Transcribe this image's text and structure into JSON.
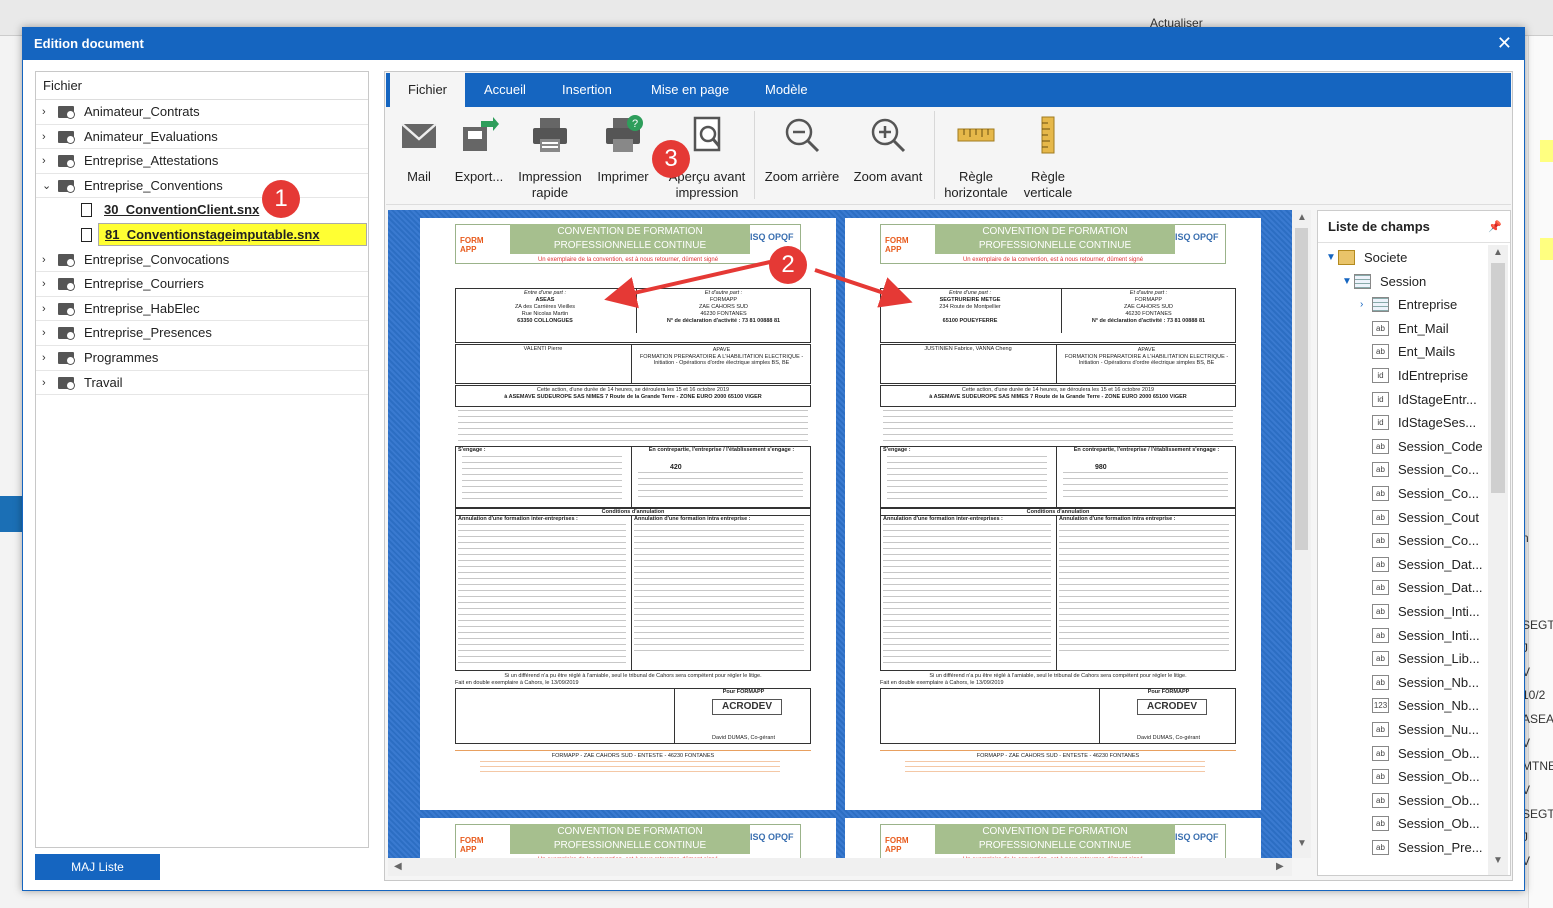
{
  "background": {
    "refresh_label": "Actualiser",
    "right_texts": [
      "n",
      "SEGT",
      "J",
      "V",
      "10/2",
      "ASEA",
      "V",
      "MTNE",
      "V",
      "SEGT",
      "J",
      "V"
    ]
  },
  "dialog": {
    "title": "Edition document",
    "close_glyph": "✕"
  },
  "tree": {
    "header": "Fichier",
    "folders": [
      {
        "label": "Animateur_Contrats",
        "expanded": false
      },
      {
        "label": "Animateur_Evaluations",
        "expanded": false
      },
      {
        "label": "Entreprise_Attestations",
        "expanded": false
      },
      {
        "label": "Entreprise_Conventions",
        "expanded": true
      },
      {
        "label": "Entreprise_Convocations",
        "expanded": false
      },
      {
        "label": "Entreprise_Courriers",
        "expanded": false
      },
      {
        "label": "Entreprise_HabElec",
        "expanded": false
      },
      {
        "label": "Entreprise_Presences",
        "expanded": false
      },
      {
        "label": "Programmes",
        "expanded": false
      },
      {
        "label": "Travail",
        "expanded": false
      }
    ],
    "files": [
      {
        "label": "30_ConventionClient.snx",
        "selected": false
      },
      {
        "label": "81_Conventionstageimputable.snx",
        "selected": true
      }
    ],
    "update_button": "MAJ Liste"
  },
  "ribbon": {
    "tabs": [
      "Fichier",
      "Accueil",
      "Insertion",
      "Mise en page",
      "Modèle"
    ],
    "active_tab": "Fichier",
    "buttons": [
      {
        "label": "Mail",
        "icon": "mail-icon"
      },
      {
        "label": "Export...",
        "icon": "export-icon"
      },
      {
        "label": "Impression rapide",
        "icon": "quick-print-icon"
      },
      {
        "label": "Imprimer",
        "icon": "print-icon"
      },
      {
        "label": "Aperçu avant impression",
        "icon": "print-preview-icon"
      },
      {
        "label": "Zoom arrière",
        "icon": "zoom-out-icon"
      },
      {
        "label": "Zoom avant",
        "icon": "zoom-in-icon"
      },
      {
        "label": "Règle horizontale",
        "icon": "horizontal-ruler-icon"
      },
      {
        "label": "Règle verticale",
        "icon": "vertical-ruler-icon"
      }
    ]
  },
  "preview": {
    "doc_title_1": "CONVENTION DE FORMATION",
    "doc_title_2": "PROFESSIONNELLE CONTINUE",
    "logo_left": "FORM APP",
    "logo_right": "ISQ OPQF",
    "subtitle": "Un exemplaire de la convention, est à nous retourner, dûment signé",
    "pages": [
      {
        "party_label": "Entre d'une part :",
        "party_name": "ASEAS",
        "party_addr1": "ZA des Carrières Vieilles",
        "party_addr2": "Rue Nicolas Martin",
        "party_addr3": "63350 COLLONGUES",
        "participant": "VALENTI Pierre",
        "price": "420"
      },
      {
        "party_label": "Entre d'une part :",
        "party_name": "SEGTRUREIRE METGE",
        "party_addr1": "234 Route de Montpellier",
        "party_addr2": "",
        "party_addr3": "65100 POUEYFERRE",
        "participant": "JUSTINIEN Fabrice, VANNA Cheng",
        "price": "980"
      }
    ],
    "other_party_label": "Et d'autre part :",
    "other_party_name": "FORMAPP",
    "other_party_addr1": "ZAE CAHORS SUD",
    "other_party_addr2": "46230 FONTANES",
    "other_party_decl": "N° de déclaration d'activité : 73 81 00888 81",
    "course_org": "APAVE",
    "course_title": "FORMATION PREPARATOIRE A L'HABILITATION ELECTRIQUE - Initiation - Opérations d'ordre électrique simples BS, BE",
    "duration_line": "Cette action, d'une durée de 14 heures, se déroulera les 15 et 16 octobre 2019",
    "location_line": "à ASEMAVE SUDEUROPE SAS NIMES 7 Route de la Grande Terre - ZONE EURO 2000 65100 VIGER",
    "engage_label": "S'engage :",
    "counterpart_label": "En contrepartie, l'entreprise / l'établissement s'engage :",
    "conditions_label": "Conditions d'annulation",
    "cancel_inter": "Annulation d'une formation inter-entreprises :",
    "cancel_intra": "Annulation d'une formation intra entreprise :",
    "litigation": "Si un différend n'a pu être réglé à l'amiable, seul le tribunal de Cahors sera compétent pour régler le litige.",
    "signed_at": "Fait en double exemplaire à Cahors, le 13/09/2019",
    "pour": "Pour FORMAPP",
    "stamp": "ACRODEV",
    "signer": "David DUMAS, Co-gérant",
    "footer": "FORMAPP - ZAE CAHORS SUD - ENTESTE - 46230 FONTANES"
  },
  "fields": {
    "header": "Liste de champs",
    "items": [
      {
        "label": "Societe",
        "kind": "db",
        "level": 0,
        "expand": "▼"
      },
      {
        "label": "Session",
        "kind": "table",
        "level": 1,
        "expand": "▼"
      },
      {
        "label": "Entreprise",
        "kind": "table",
        "level": 2,
        "expand": "›"
      },
      {
        "label": "Ent_Mail",
        "kind": "ab",
        "level": 2
      },
      {
        "label": "Ent_Mails",
        "kind": "ab",
        "level": 2
      },
      {
        "label": "IdEntreprise",
        "kind": "id",
        "level": 2
      },
      {
        "label": "IdStageEntr...",
        "kind": "id",
        "level": 2
      },
      {
        "label": "IdStageSes...",
        "kind": "id",
        "level": 2
      },
      {
        "label": "Session_Code",
        "kind": "ab",
        "level": 2
      },
      {
        "label": "Session_Co...",
        "kind": "ab",
        "level": 2
      },
      {
        "label": "Session_Co...",
        "kind": "ab",
        "level": 2
      },
      {
        "label": "Session_Cout",
        "kind": "ab",
        "level": 2
      },
      {
        "label": "Session_Co...",
        "kind": "ab",
        "level": 2
      },
      {
        "label": "Session_Dat...",
        "kind": "ab",
        "level": 2
      },
      {
        "label": "Session_Dat...",
        "kind": "ab",
        "level": 2
      },
      {
        "label": "Session_Inti...",
        "kind": "ab",
        "level": 2
      },
      {
        "label": "Session_Inti...",
        "kind": "ab",
        "level": 2
      },
      {
        "label": "Session_Lib...",
        "kind": "ab",
        "level": 2
      },
      {
        "label": "Session_Nb...",
        "kind": "ab",
        "level": 2
      },
      {
        "label": "Session_Nb...",
        "kind": "123",
        "level": 2
      },
      {
        "label": "Session_Nu...",
        "kind": "ab",
        "level": 2
      },
      {
        "label": "Session_Ob...",
        "kind": "ab",
        "level": 2
      },
      {
        "label": "Session_Ob...",
        "kind": "ab",
        "level": 2
      },
      {
        "label": "Session_Ob...",
        "kind": "ab",
        "level": 2
      },
      {
        "label": "Session_Ob...",
        "kind": "ab",
        "level": 2
      },
      {
        "label": "Session_Pre...",
        "kind": "ab",
        "level": 2
      }
    ]
  },
  "annotations": [
    "1",
    "2",
    "3"
  ]
}
